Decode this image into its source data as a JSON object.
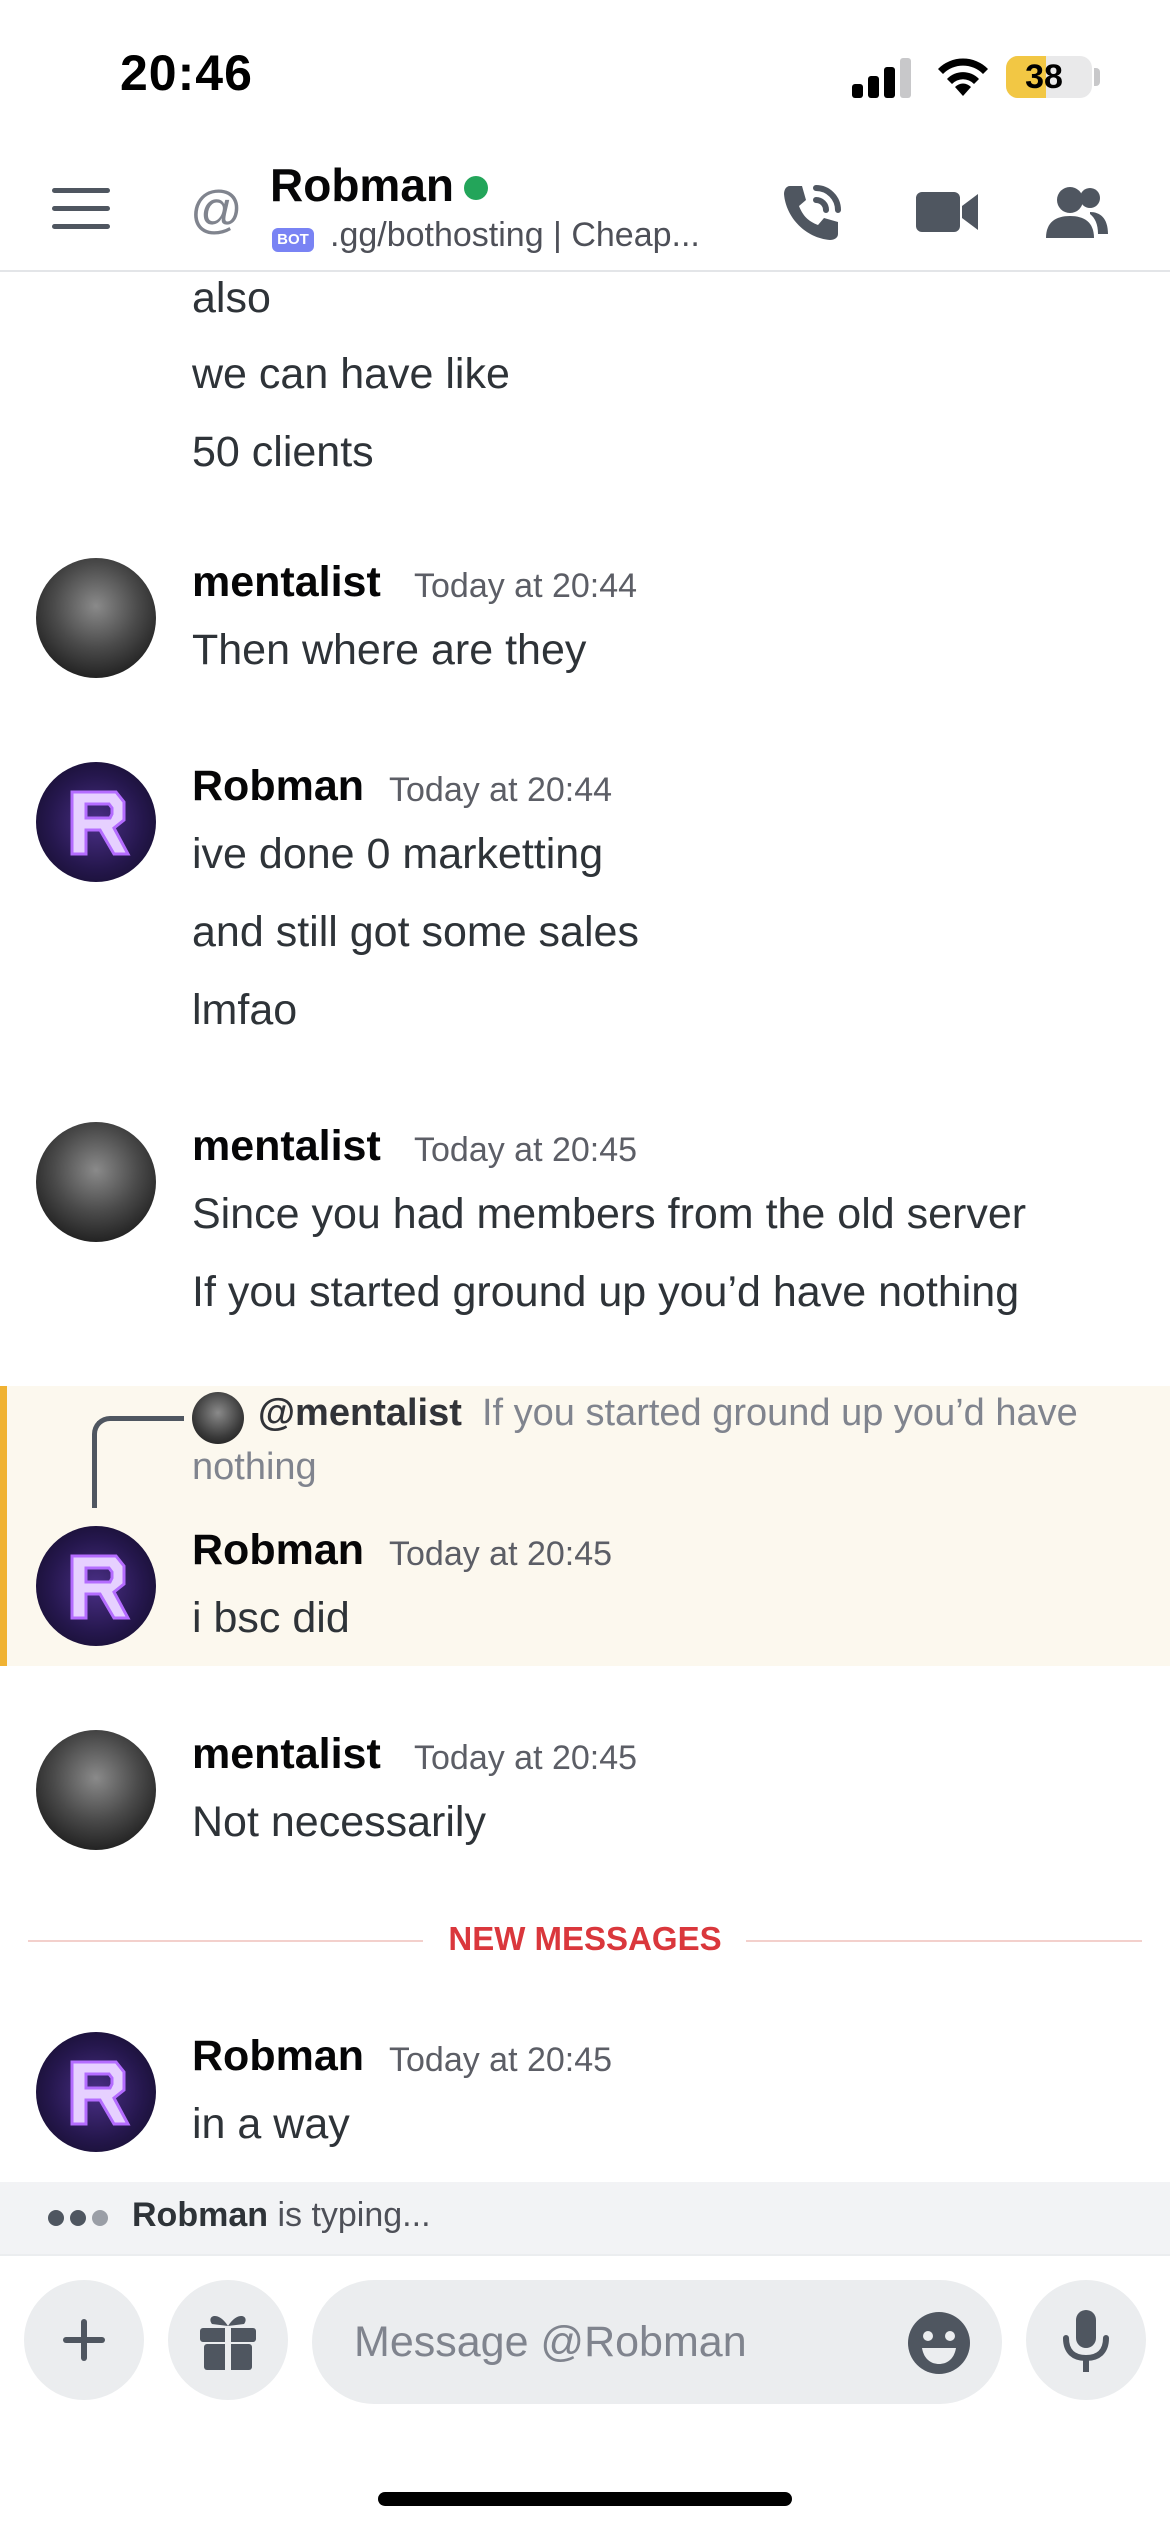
{
  "status_bar": {
    "time": "20:46",
    "battery": "38"
  },
  "header": {
    "at_symbol": "@",
    "name": "Robman",
    "bot_badge": "BOT",
    "subtitle": ".gg/bothosting | Cheap..."
  },
  "messages": {
    "m0": {
      "lines": [
        "also",
        "we can have like",
        "50 clients"
      ]
    },
    "m1": {
      "author": "mentalist",
      "timestamp": "Today at 20:44",
      "lines": [
        "Then where are they"
      ]
    },
    "m2": {
      "author": "Robman",
      "timestamp": "Today at 20:44",
      "lines": [
        "ive done 0 marketting",
        "and still got some sales",
        "lmfao"
      ]
    },
    "m3": {
      "author": "mentalist",
      "timestamp": "Today at 20:45",
      "lines": [
        "Since you had members from the old server",
        "If you started ground up you’d have nothing"
      ]
    },
    "m4": {
      "reply_to": "@mentalist",
      "reply_text_1": "If you started ground up you’d have",
      "reply_text_2": "nothing",
      "author": "Robman",
      "timestamp": "Today at 20:45",
      "lines": [
        "i bsc did"
      ]
    },
    "m5": {
      "author": "mentalist",
      "timestamp": "Today at 20:45",
      "lines": [
        "Not necessarily"
      ]
    },
    "divider": "NEW MESSAGES",
    "m6": {
      "author": "Robman",
      "timestamp": "Today at 20:45",
      "lines": [
        "in a way"
      ]
    }
  },
  "typing": {
    "user": "Robman",
    "text": "is typing..."
  },
  "composer": {
    "placeholder": "Message @Robman"
  },
  "colors": {
    "online": "#23a55a",
    "highlight_border": "#f0b232",
    "new_messages": "#da373c"
  },
  "icons": [
    "hamburger-icon",
    "phone-call-icon",
    "video-camera-icon",
    "members-icon",
    "plus-icon",
    "gift-icon",
    "emoji-icon",
    "microphone-icon"
  ]
}
